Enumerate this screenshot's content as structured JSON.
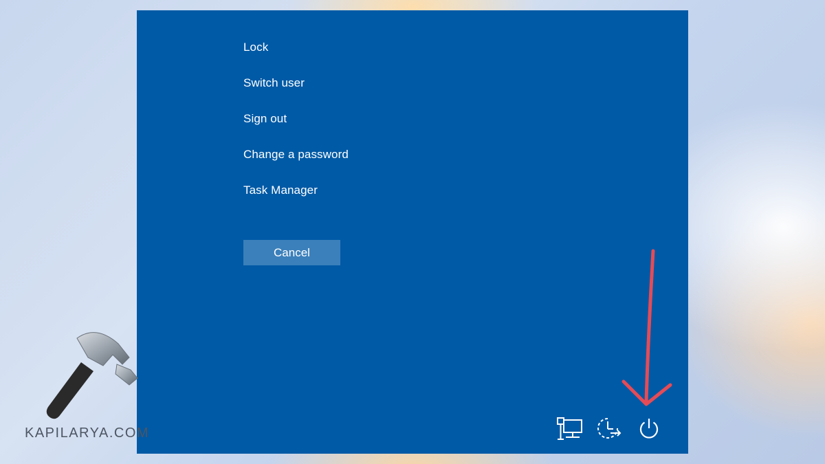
{
  "dialog": {
    "menu_items": [
      {
        "label": "Lock"
      },
      {
        "label": "Switch user"
      },
      {
        "label": "Sign out"
      },
      {
        "label": "Change a password"
      },
      {
        "label": "Task Manager"
      }
    ],
    "cancel_label": "Cancel",
    "tray_icons": [
      {
        "icon": "network-icon"
      },
      {
        "icon": "accessibility-icon"
      },
      {
        "icon": "power-icon"
      }
    ],
    "background_color": "#005aa6",
    "button_color": "#3b80bb"
  },
  "annotation": {
    "arrow_color": "#e54b56",
    "points_to": "power-icon"
  },
  "watermark": {
    "text": "KAPILARYA.COM",
    "icon": "hammer-icon"
  }
}
